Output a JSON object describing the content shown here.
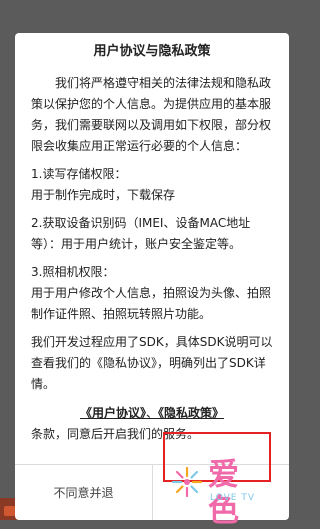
{
  "dialog": {
    "title": "用户协议与隐私政策",
    "paragraphs": [
      "我们将严格遵守相关的法律法规和隐私政策以保护您的个人信息。为提供应用的基本服务，我们需要联网以及调用如下权限，部分权限会收集应用正常运行必要的个人信息：",
      "1.读写存储权限：",
      "用于制作完成时，下载保存",
      "2.获取设备识别码（IMEI、设备MAC地址等）：用于用户统计，账户安全鉴定等。",
      "3.照相机权限：",
      "用于用户修改个人信息，拍照设为头像、拍照制作证件照、拍照玩转照片功能。",
      "我们开发过程应用了SDK，具体SDK说明可以查看我们的《隐私协议》，明确列出了SDK详情。"
    ],
    "links": {
      "user_agreement": "《用户协议》",
      "separator": "、",
      "privacy_policy": "《隐私政策》"
    },
    "notice": "条款，同意后开启我们的服务。",
    "buttons": {
      "decline": "不同意并退",
      "accept": ""
    }
  },
  "watermark": {
    "text": "爱色",
    "subtext": "LOVE TV"
  }
}
